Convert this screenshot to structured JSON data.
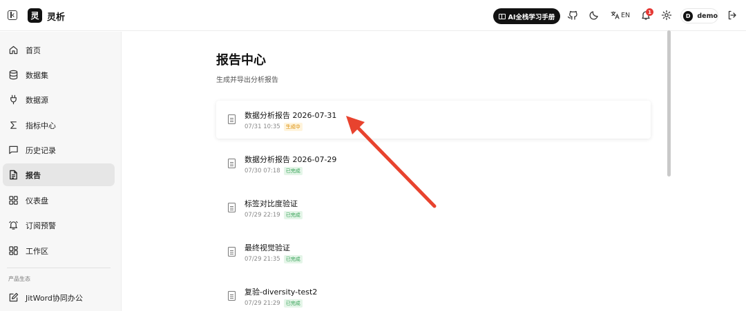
{
  "header": {
    "app_name": "灵析",
    "logo_char": "灵",
    "manual_button": "AI全栈学习手册",
    "lang_label": "EN",
    "notification_count": "1",
    "user_initial": "D",
    "user_name": "demo"
  },
  "sidebar": {
    "items": [
      {
        "label": "首页",
        "icon": "home-icon"
      },
      {
        "label": "数据集",
        "icon": "database-icon"
      },
      {
        "label": "数据源",
        "icon": "plug-icon"
      },
      {
        "label": "指标中心",
        "icon": "sigma-icon"
      },
      {
        "label": "历史记录",
        "icon": "chat-icon"
      },
      {
        "label": "报告",
        "icon": "document-icon",
        "active": true
      },
      {
        "label": "仪表盘",
        "icon": "dashboard-icon"
      },
      {
        "label": "订阅预警",
        "icon": "bell-icon"
      },
      {
        "label": "工作区",
        "icon": "workspace-icon"
      }
    ],
    "section_title": "产品生态",
    "eco_items": [
      {
        "label": "JitWord协同办公",
        "icon": "edit-icon"
      }
    ]
  },
  "main": {
    "title": "报告中心",
    "subtitle": "生成并导出分析报告",
    "reports": [
      {
        "title": "数据分析报告 2026-07-31",
        "time": "07/31 10:35",
        "status": "生成中"
      },
      {
        "title": "数据分析报告 2026-07-29",
        "time": "07/30 07:18",
        "status": "已完成"
      },
      {
        "title": "标签对比度验证",
        "time": "07/29 22:19",
        "status": "已完成"
      },
      {
        "title": "最终视觉验证",
        "time": "07/29 21:35",
        "status": "已完成"
      },
      {
        "title": "复验-diversity-test2",
        "time": "07/29 21:29",
        "status": "已完成"
      }
    ]
  },
  "colors": {
    "arrow": "#e8432e",
    "status_in_progress": "#d98a00",
    "status_done": "#2e9e4f"
  }
}
